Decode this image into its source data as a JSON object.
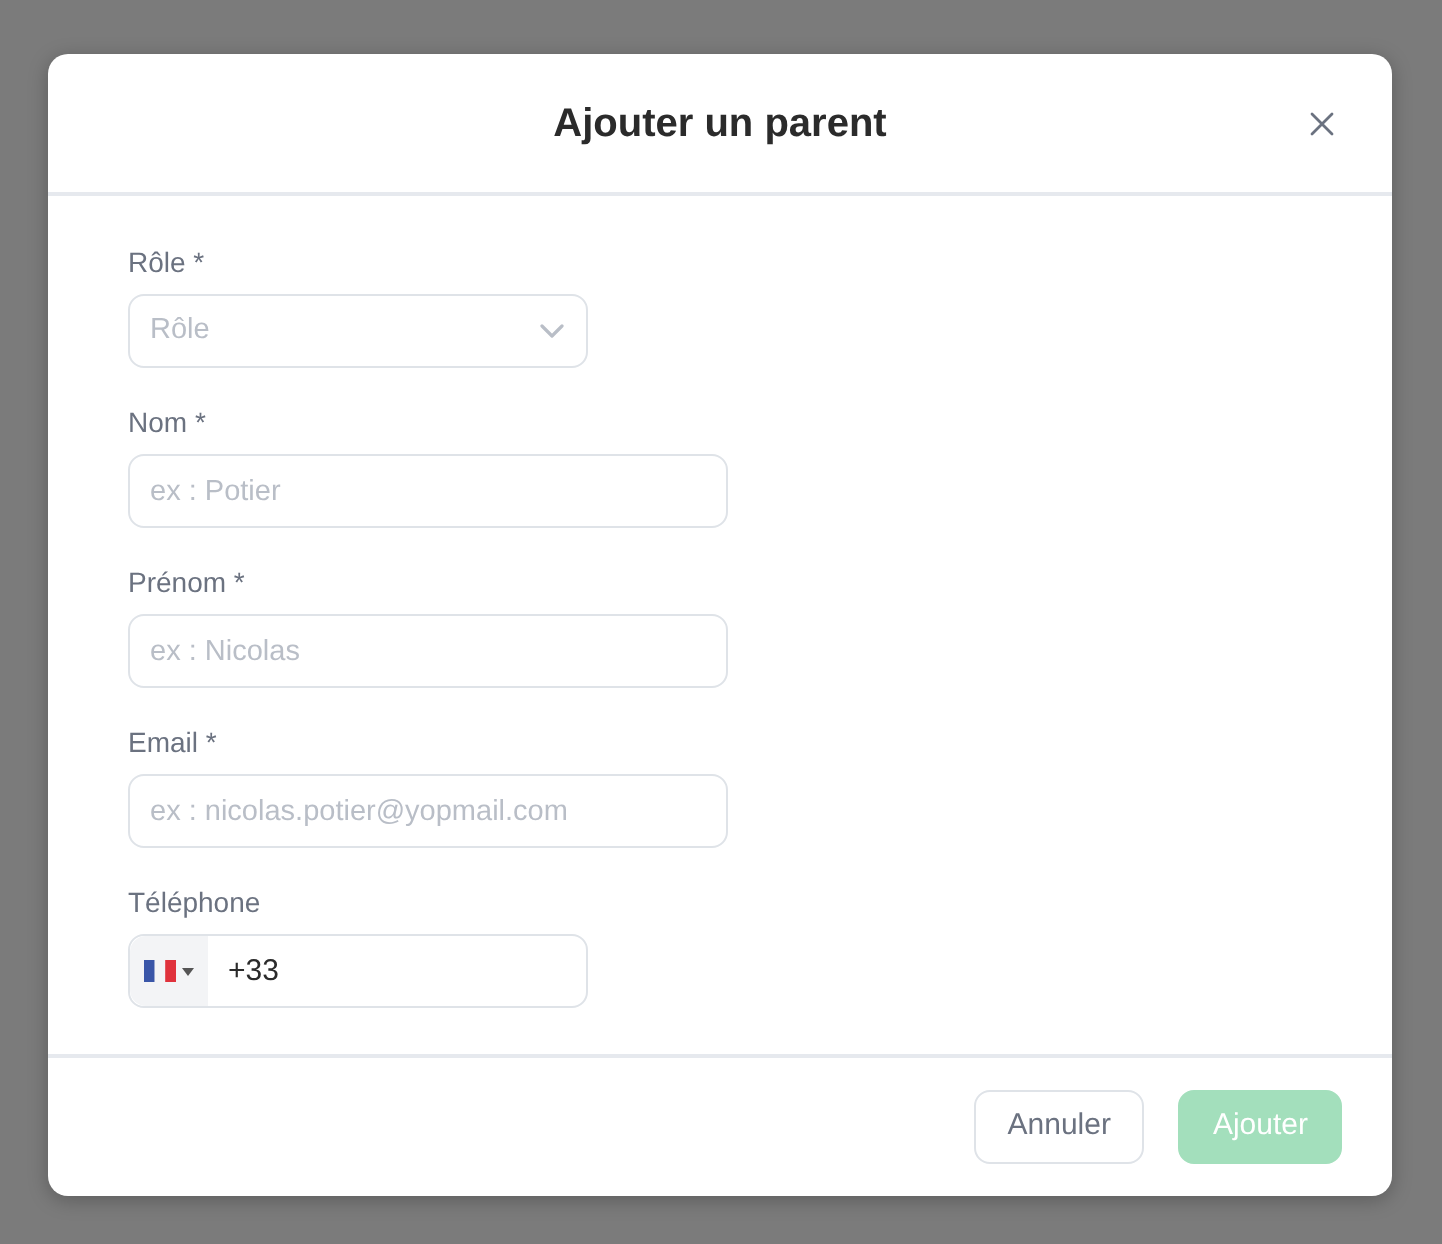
{
  "dialog": {
    "title": "Ajouter un parent"
  },
  "fields": [
    {
      "kind": "select",
      "label": "Rôle *",
      "placeholder": "Rôle"
    },
    {
      "kind": "text",
      "label": "Nom *",
      "placeholder": "ex : Potier"
    },
    {
      "kind": "text",
      "label": "Prénom *",
      "placeholder": "ex : Nicolas"
    },
    {
      "kind": "text",
      "label": "Email *",
      "placeholder": "ex : nicolas.potier@yopmail.com"
    },
    {
      "kind": "phone",
      "label": "Téléphone",
      "value": "+33"
    }
  ],
  "buttons": [
    {
      "kind": "secondary",
      "label": "Annuler",
      "disabled": false
    },
    {
      "kind": "primary",
      "label": "Ajouter",
      "disabled": true
    }
  ]
}
